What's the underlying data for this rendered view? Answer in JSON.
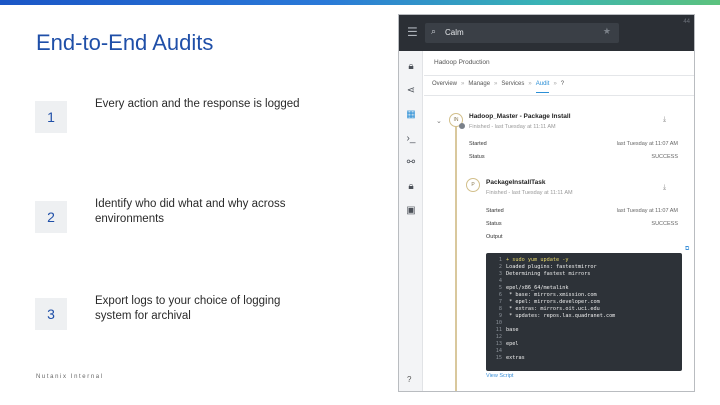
{
  "slide": {
    "title": "End-to-End Audits",
    "steps": [
      {
        "number": "1",
        "text": "Every action and the response is logged"
      },
      {
        "number": "2",
        "text": "Identify who did what and why across environments"
      },
      {
        "number": "3",
        "text": "Export logs to your choice of logging system for archival"
      }
    ],
    "footer": "Nutanix Internal"
  },
  "colors": {
    "title": "#1f4fa8",
    "app_header": "#2b2f35",
    "accent": "#2b8fd6",
    "terminal_bg": "#2d3238"
  },
  "app": {
    "search": {
      "value": "Calm",
      "icon": "search-icon",
      "star_icon": "star-icon"
    },
    "counter": "44",
    "rail_icons": [
      "lock-icon",
      "share-icon",
      "apps-icon",
      "terminal-icon",
      "link-icon",
      "lock-icon",
      "copy-icon"
    ],
    "help": "?",
    "breadcrumb": "Hadoop Production",
    "tabs": [
      {
        "label": "Overview"
      },
      {
        "label": "Manage"
      },
      {
        "label": "Services"
      },
      {
        "label": "Audit"
      },
      {
        "label": "?"
      }
    ],
    "tab_sep": "»",
    "audit": {
      "entry1": {
        "node_label": "IN",
        "title": "Hadoop_Master - Package Install",
        "subtitle": "Finished - last Tuesday at 11:11 AM",
        "started_label": "Started",
        "started_value": "last Tuesday at 11:07 AM",
        "status_label": "Status",
        "status_value": "SUCCESS"
      },
      "entry2": {
        "node_label": "P",
        "title": "PackageInstallTask",
        "subtitle": "Finished - last Tuesday at 11:11 AM",
        "started_label": "Started",
        "started_value": "last Tuesday at 11:07 AM",
        "status_label": "Status",
        "status_value": "SUCCESS",
        "output_label": "Output"
      },
      "terminal_lines": [
        {
          "n": "1",
          "text": "+ sudo yum update -y",
          "cmd": true
        },
        {
          "n": "2",
          "text": "Loaded plugins: fastestmirror"
        },
        {
          "n": "3",
          "text": "Determining fastest mirrors"
        },
        {
          "n": "4",
          "text": ""
        },
        {
          "n": "5",
          "text": "epel/x86_64/metalink"
        },
        {
          "n": "6",
          "text": " * base: mirrors.xmission.com"
        },
        {
          "n": "7",
          "text": " * epel: mirrors.developer.com"
        },
        {
          "n": "8",
          "text": " * extras: mirrors.oit.uci.edu"
        },
        {
          "n": "9",
          "text": " * updates: repos.lax.quadranet.com"
        },
        {
          "n": "10",
          "text": ""
        },
        {
          "n": "11",
          "text": "base"
        },
        {
          "n": "12",
          "text": ""
        },
        {
          "n": "13",
          "text": "epel"
        },
        {
          "n": "14",
          "text": ""
        },
        {
          "n": "15",
          "text": "extras"
        }
      ],
      "view_script": "View Script"
    }
  }
}
